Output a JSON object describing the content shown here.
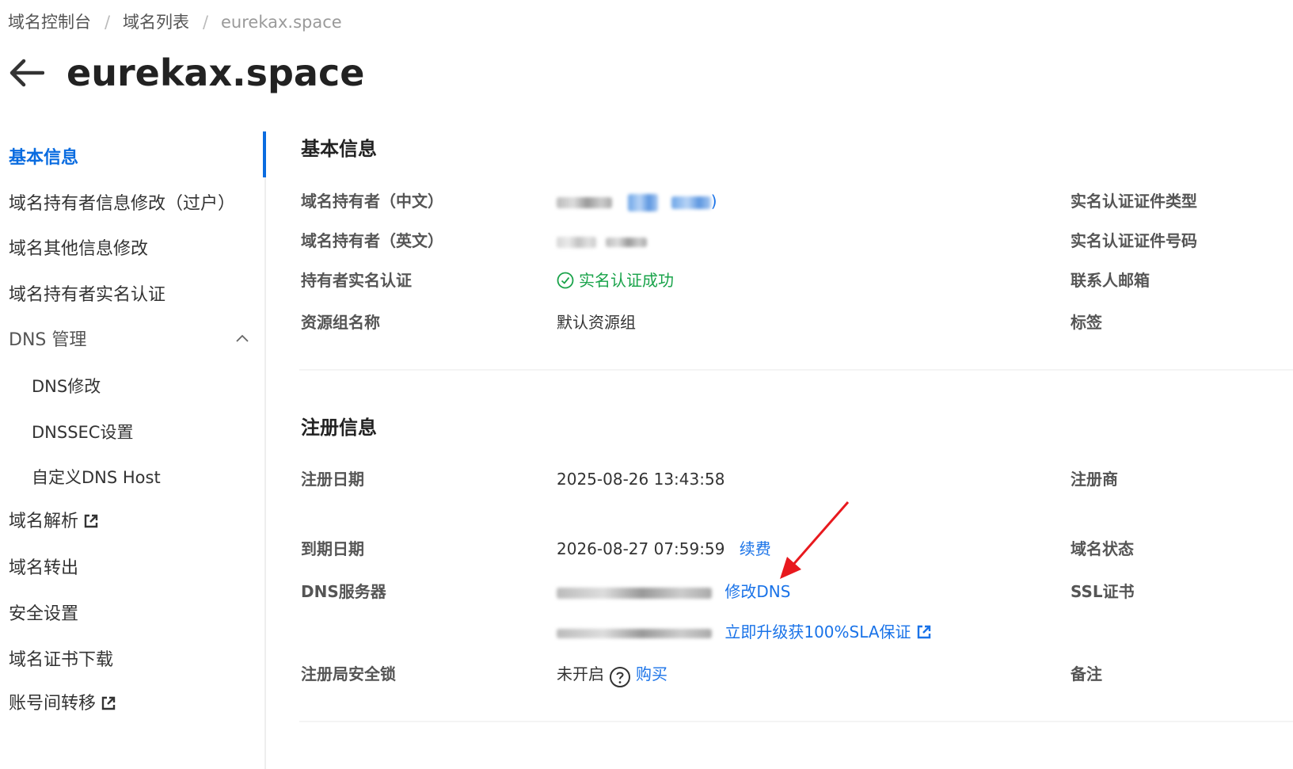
{
  "breadcrumb": {
    "items": [
      "域名控制台",
      "域名列表",
      "eurekax.space"
    ],
    "separator": "/"
  },
  "header": {
    "title": "eurekax.space",
    "back_icon": "arrow-left-icon"
  },
  "sidebar": {
    "items": [
      {
        "label": "基本信息",
        "active": true
      },
      {
        "label": "域名持有者信息修改（过户）"
      },
      {
        "label": "域名其他信息修改"
      },
      {
        "label": "域名持有者实名认证"
      },
      {
        "label": "DNS 管理",
        "expanded": true
      },
      {
        "label": "DNS修改"
      },
      {
        "label": "DNSSEC设置"
      },
      {
        "label": "自定义DNS Host"
      },
      {
        "label": "域名解析",
        "icon": "external-link-icon"
      },
      {
        "label": "域名转出"
      },
      {
        "label": "安全设置"
      },
      {
        "label": "域名证书下载"
      },
      {
        "label": "账号间转移",
        "icon": "external-link-icon"
      }
    ]
  },
  "basic_info": {
    "title": "基本信息",
    "owner_cn_label": "域名持有者（中文）",
    "owner_cn_suffix": ")",
    "owner_en_label": "域名持有者（英文）",
    "verify_label": "持有者实名认证",
    "verify_value": "实名认证成功",
    "resource_group_label": "资源组名称",
    "resource_group_value": "默认资源组",
    "right_labels": [
      "实名认证证件类型",
      "实名认证证件号码",
      "联系人邮箱",
      "标签"
    ]
  },
  "registration": {
    "title": "注册信息",
    "reg_date_label": "注册日期",
    "reg_date_value": "2025-08-26 13:43:58",
    "exp_date_label": "到期日期",
    "exp_date_value": "2026-08-27 07:59:59",
    "renew_link": "续费",
    "dns_label": "DNS服务器",
    "dns_modify_link": "修改DNS",
    "dns_upgrade_link": "立即升级获100%SLA保证",
    "lock_label": "注册局安全锁",
    "lock_value": "未开启",
    "buy_link": "购买",
    "right_labels": [
      "注册商",
      "域名状态",
      "SSL证书",
      "备注"
    ]
  },
  "colors": {
    "accent": "#0a6ce0",
    "link": "#1a73e8",
    "success": "#19a34a",
    "annotation_arrow": "#e8191e"
  }
}
